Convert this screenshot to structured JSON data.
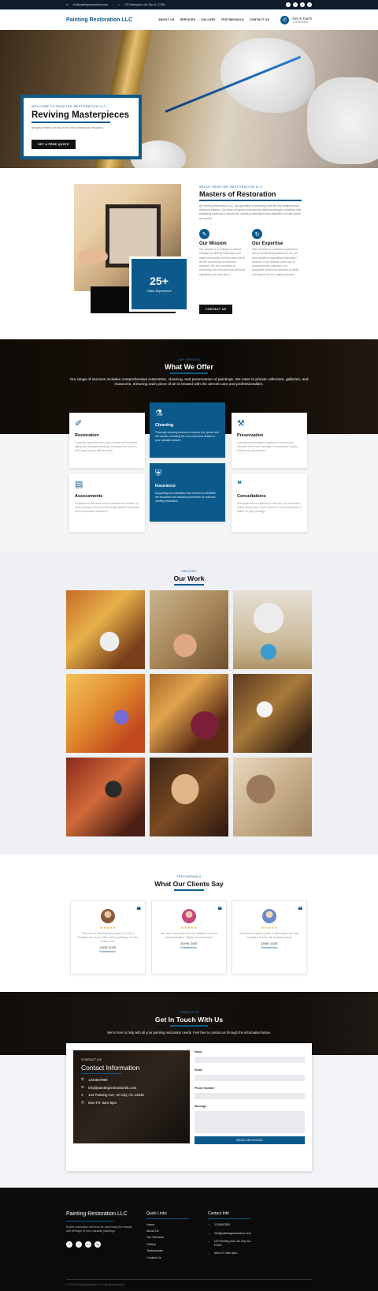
{
  "topbar": {
    "email": "info@paintingrestorationllc.com",
    "address": "123 Painting Ave, Art City, AC 12345",
    "socials": [
      "f",
      "t",
      "in",
      "ig"
    ]
  },
  "header": {
    "logo": "Painting Restoration LLC",
    "nav": [
      "ABOUT US",
      "SERVICES",
      "GALLERY",
      "TESTIMONIALS",
      "CONTACT US"
    ],
    "get_in_touch": "Get In Touch",
    "phone": "1234567890"
  },
  "hero": {
    "eyebrow": "WELCOME TO PAINTING RESTORATION LLC",
    "title": "Reviving Masterpieces",
    "subtitle": "Bringing timeless art back to life with professional restoration.",
    "cta": "GET A FREE QUOTE"
  },
  "about": {
    "eyebrow": "ABOUT PAINTING RESTORATION LLC",
    "title": "Masters of Restoration",
    "lead": "At Painting Restoration LLC, we specialize in breathing new life into treasured and historical artwork. Our team of experts employs the latest techniques combined with traditional methods to ensure the utmost preservation and restoration of each piece we handle.",
    "badge_num": "25+",
    "badge_label": "Years Experience",
    "mission_title": "Our Mission",
    "mission_text": "Our mission is to safeguard cultural heritage by offering meticulous and skilled restoration services that extend the life and beauty of treasured artworks. We are committed to preserving the emotional and historical significance of each piece.",
    "expertise_title": "Our Expertise",
    "expertise_text": "With decades of combined experience and an unwavering passion for art, our team delivers unparalleled restoration services. From delicate touch-ups to comprehensive overhauls, we guarantee meticulous attention to detail and respect for the original artworks.",
    "cta": "CONTACT US"
  },
  "services": {
    "eyebrow": "OUR SERVICES",
    "title": "What We Offer",
    "intro": "Our range of services includes comprehensive restoration, cleaning, and preservation of paintings. We cater to private collectors, galleries, and museums, ensuring each piece of art is treated with the utmost care and professionalism.",
    "items": [
      {
        "title": "Restoration",
        "text": "Complete restoration services to repair and revitalize aging and damaged paintings, bringing them back to their original glory with precision."
      },
      {
        "title": "Cleaning",
        "text": "Thorough cleaning services to remove dirt, grime, and old varnish, revealing the true colors and details of your valuable artwork."
      },
      {
        "title": "Preservation",
        "text": "Long-term preservation solutions to protect your artworks from future damage, ensuring their beauty endures for generations."
      },
      {
        "title": "Assessments",
        "text": "Professional assessments to evaluate the condition of your paintings and recommend appropriate restoration and preservation measures."
      },
      {
        "title": "Insurance",
        "text": "Supporting documentation and services to facilitate the insurance and valuation processes for artworks needing restoration."
      },
      {
        "title": "Consultations",
        "text": "Personalized consultations to discuss your restoration needs and provide expert advice on the best course of action for your paintings."
      }
    ]
  },
  "gallery": {
    "eyebrow": "GALLERY",
    "title": "Our Work"
  },
  "testimonials": {
    "eyebrow": "TESTIMONIALS",
    "title": "What Our Clients Say",
    "items": [
      {
        "stars": "★★★★★",
        "quote": "The team at Painting Restoration LLC did a fantastic job on our 19th-century painting. It looks brand new!",
        "name": "JANE DOE",
        "role": "Entrepreneur"
      },
      {
        "stars": "★★★★★",
        "quote": "We were impressed with the detailed work and professionalism. Highly recommended!",
        "name": "JOHN DOE",
        "role": "Entrepreneur"
      },
      {
        "stars": "★★★★★",
        "quote": "My heirloom painting was in bad shape, but they brought it back to life. Amazing work!",
        "name": "JANE DOE",
        "role": "Entrepreneur"
      }
    ]
  },
  "contact": {
    "eyebrow": "CONTACT US",
    "title": "Get In Touch With Us",
    "intro": "We're here to help with all your painting restoration needs. Feel free to contact us through the information below.",
    "info_eyebrow": "CONTACT US",
    "info_title": "Contact Information",
    "phone": "1234567890",
    "email": "info@paintingrestorationllc.com",
    "address": "123 Painting Ave, Art City, AC 12345",
    "hours": "Mon-Fri: 9am-6pm",
    "form": {
      "name_label": "Name",
      "email_label": "Email",
      "phone_label": "Phone Number",
      "message_label": "Message",
      "submit": "SEND MESSAGE"
    }
  },
  "footer": {
    "brand": "Painting Restoration LLC",
    "desc": "Expert restoration services for preserving the beauty and heritage of your valuable paintings.",
    "quick_links_title": "Quick Links",
    "links": [
      "Home",
      "About Us",
      "Our Services",
      "Gallery",
      "Testimonials",
      "Contact Us"
    ],
    "contact_title": "Contact Info",
    "phone": "1234567890",
    "email": "info@paintingrestoration.com",
    "address": "123 Painting Ave, Art City, AC 12345",
    "hours": "Mon-Fri: 9am-6pm",
    "copyright": "© 2024 Painting Restoration LLC. All rights reserved."
  },
  "colors": {
    "brand": "#0c5a8c",
    "dark": "#0b0b0b",
    "star": "#f4a623"
  }
}
